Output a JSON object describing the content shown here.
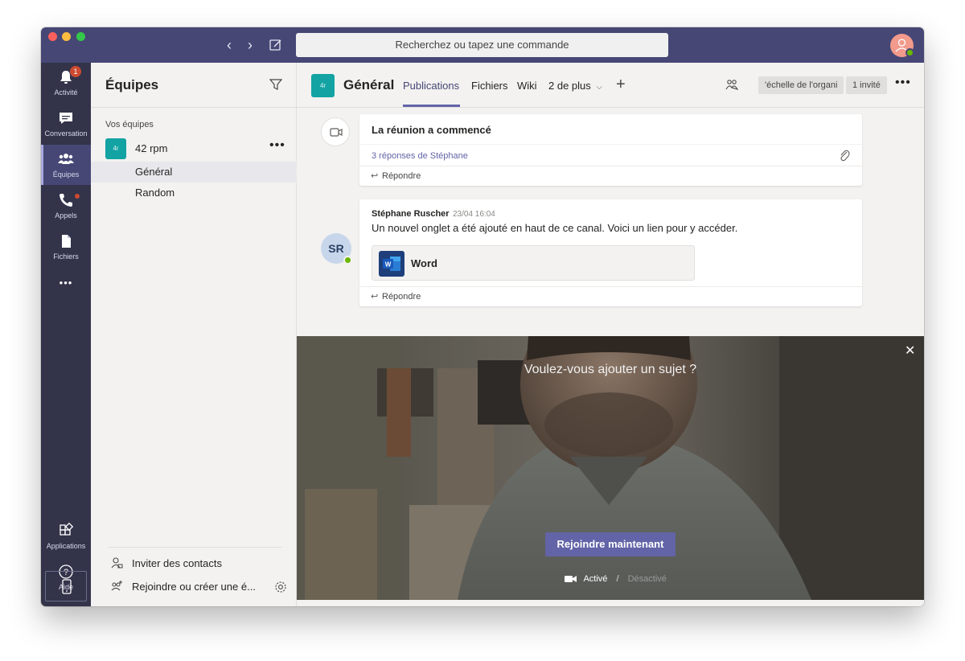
{
  "titlebar": {
    "search_placeholder": "Recherchez ou tapez une commande"
  },
  "appbar": {
    "activity_label": "Activité",
    "activity_badge": "1",
    "chat_label": "Conversation",
    "teams_label": "Équipes",
    "calls_label": "Appels",
    "files_label": "Fichiers",
    "more_label": "•••",
    "apps_label": "Applications",
    "help_label": "Aide"
  },
  "teams_panel": {
    "title": "Équipes",
    "section_label": "Vos équipes",
    "team": {
      "avatar_text": "4r",
      "name": "42 rpm",
      "more": "•••"
    },
    "channels": [
      {
        "label": "Général",
        "selected": true
      },
      {
        "label": "Random",
        "selected": false
      }
    ],
    "invite_label": "Inviter des contacts",
    "join_label": "Rejoindre ou créer une é..."
  },
  "channel_header": {
    "avatar_text": "4r",
    "title": "Général",
    "tabs": [
      "Publications",
      "Fichiers",
      "Wiki",
      "2 de plus"
    ],
    "plus": "+",
    "chip_org": "'échelle de l'organi",
    "chip_guest": "1 invité",
    "more": "•••"
  },
  "meeting_card": {
    "title": "La réunion a commencé",
    "replies": "3 réponses de Stéphane",
    "reply_label": "Répondre"
  },
  "message": {
    "avatar_initials": "SR",
    "author": "Stéphane Ruscher",
    "time": "23/04 16:04",
    "body": "Un nouvel onglet a été ajouté en haut de ce canal. Voici un lien pour y accéder.",
    "file_name": "Word",
    "reply_label": "Répondre"
  },
  "video_overlay": {
    "prompt": "Voulez-vous ajouter un sujet ?",
    "close": "✕",
    "join_button": "Rejoindre maintenant",
    "camera_on": "Activé",
    "separator": "/",
    "camera_off": "Désactivé"
  },
  "colors": {
    "titlebar": "#464775",
    "appbar": "#33344a",
    "accent": "#6264a7",
    "team_avatar": "#13a3a3",
    "badge": "#cc4a31",
    "presence": "#6bb700"
  }
}
